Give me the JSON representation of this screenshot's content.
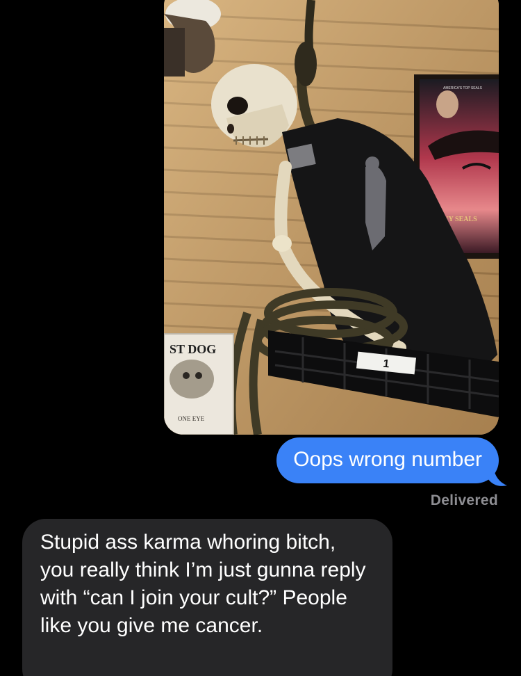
{
  "messages": {
    "outgoing_text": "Oops wrong number",
    "status": "Delivered",
    "incoming_text": "Stupid ass karma whoring bitch, you really think I’m just gunna reply with “can I join your cult?” People like you give me cancer."
  },
  "photo": {
    "sign_text": "ST DOG",
    "sign_subtext": "ONE EYE",
    "poster_title": "NAVY SEALS",
    "poster_tagline": "AMERICA'S TOP SEALS",
    "price_tag": "1"
  },
  "colors": {
    "outgoing_bubble": "#3a82f7",
    "incoming_bubble": "#262628",
    "status_text": "#8e8e93",
    "background": "#000000"
  }
}
